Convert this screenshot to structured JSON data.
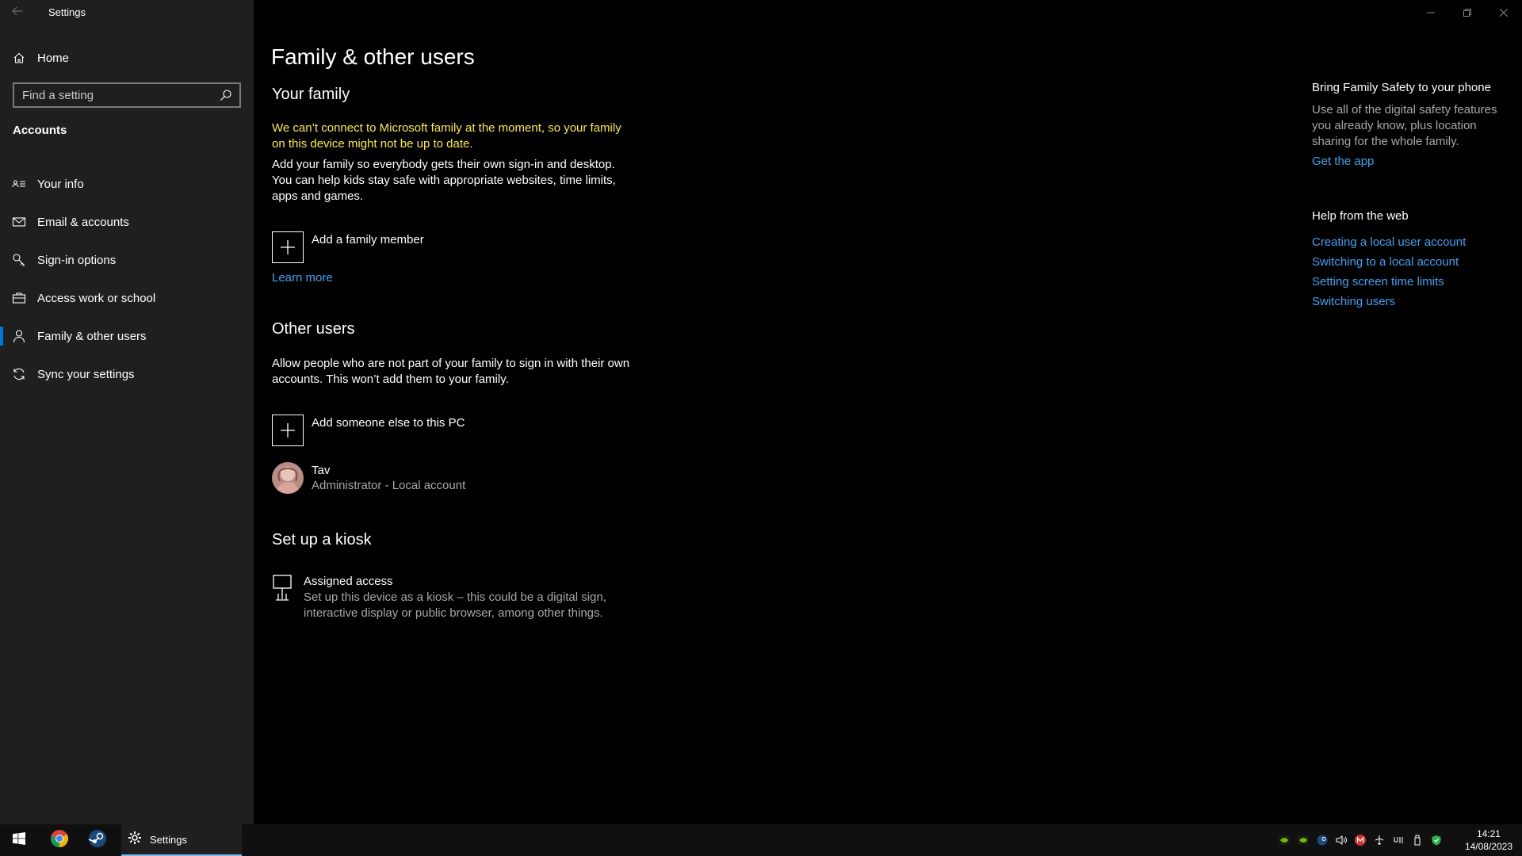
{
  "window": {
    "title": "Settings"
  },
  "sidebar": {
    "home_label": "Home",
    "search_placeholder": "Find a setting",
    "section_label": "Accounts",
    "items": [
      {
        "label": "Your info",
        "icon": "contact-card-icon"
      },
      {
        "label": "Email & accounts",
        "icon": "mail-icon"
      },
      {
        "label": "Sign-in options",
        "icon": "key-icon"
      },
      {
        "label": "Access work or school",
        "icon": "briefcase-icon"
      },
      {
        "label": "Family & other users",
        "icon": "person-icon",
        "selected": true
      },
      {
        "label": "Sync your settings",
        "icon": "sync-icon"
      }
    ]
  },
  "main": {
    "title": "Family & other users",
    "family": {
      "heading": "Your family",
      "warning": "We can’t connect to Microsoft family at the moment, so your family on this device might not be up to date.",
      "description": "Add your family so everybody gets their own sign-in and desktop. You can help kids stay safe with appropriate websites, time limits, apps and games.",
      "add_label": "Add a family member",
      "learn_more": "Learn more"
    },
    "other_users": {
      "heading": "Other users",
      "description": "Allow people who are not part of your family to sign in with their own accounts. This won’t add them to your family.",
      "add_label": "Add someone else to this PC",
      "user": {
        "name": "Tav",
        "detail": "Administrator - Local account"
      }
    },
    "kiosk": {
      "heading": "Set up a kiosk",
      "title": "Assigned access",
      "description": "Set up this device as a kiosk – this could be a digital sign, interactive display or public browser, among other things."
    }
  },
  "right": {
    "family_safety": {
      "heading": "Bring Family Safety to your phone",
      "description": "Use all of the digital safety features you already know, plus location sharing for the whole family.",
      "link": "Get the app"
    },
    "help": {
      "heading": "Help from the web",
      "links": [
        "Creating a local user account",
        "Switching to a local account",
        "Setting screen time limits",
        "Switching users"
      ]
    }
  },
  "taskbar": {
    "settings_label": "Settings",
    "time": "14:21",
    "date": "14/08/2023"
  },
  "colors": {
    "accent": "#0078d7",
    "link": "#3fa3f2",
    "warning": "#ffeb3b"
  }
}
